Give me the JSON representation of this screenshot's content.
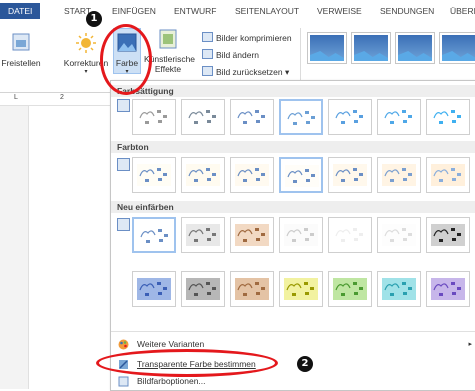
{
  "tabs": [
    "DATEI",
    "START",
    "EINFÜGEN",
    "ENTWURF",
    "SEITENLAYOUT",
    "VERWEISE",
    "SENDUNGEN",
    "ÜBERP"
  ],
  "ribbon": {
    "freistellen": "Freistellen",
    "korrekturen": "Korrekturen",
    "farbe": "Farbe",
    "kuenstlerische1": "Künstlerische",
    "kuenstlerische2": "Effekte",
    "bilder_komprimieren": "Bilder komprimieren",
    "bild_aendern": "Bild ändern",
    "bild_zuruecksetzen": "Bild zurücksetzen"
  },
  "ruler": {
    "marker": "L",
    "num": "2"
  },
  "dropdown": {
    "section1": "Farbsättigung",
    "section2": "Farbton",
    "section3": "Neu einfärben",
    "item_weitere": "Weitere Varianten",
    "item_transparent": "Transparente Farbe bestimmen",
    "item_bildfarb": "Bildfarboptionen..."
  },
  "annotations": {
    "one": "1",
    "two": "2"
  },
  "colors": {
    "accent": "#2b579a",
    "annotation_red": "#e4181c",
    "recolor": [
      "#ffffff",
      "#e8e8e8",
      "#f2d9c3",
      "#fbfbfb",
      "#ffffff",
      "#fdfdfd",
      "#d0d0d0",
      "#9fb7e6",
      "#b7b7b7",
      "#e4c3a5",
      "#f2f2a0",
      "#bfe6a2",
      "#a0e2e8",
      "#c7b6ea",
      "#f0b0e0"
    ]
  }
}
